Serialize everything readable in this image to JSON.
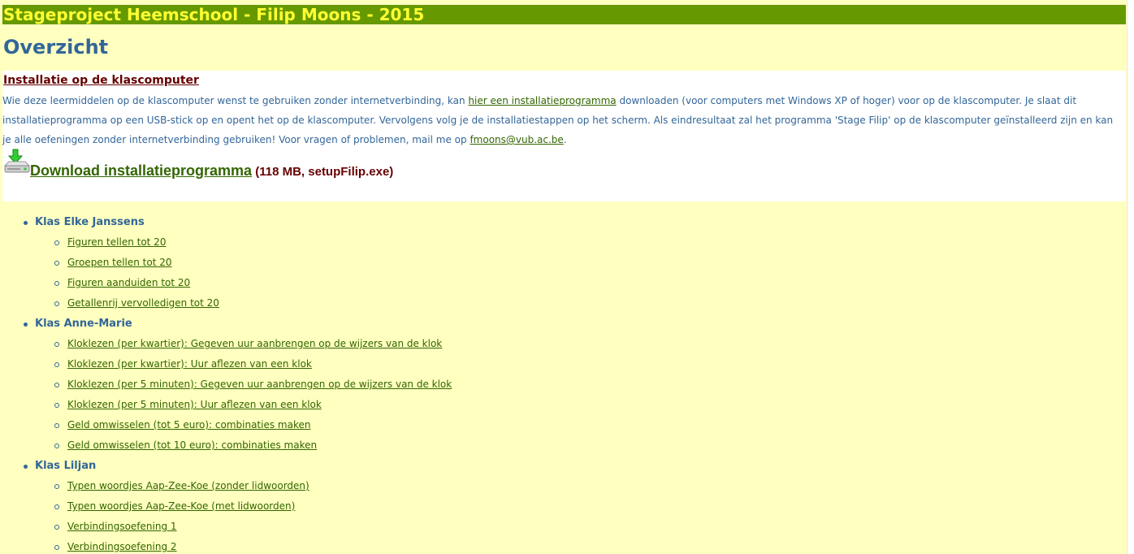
{
  "header": {
    "site_title": "Stageproject Heemschool - Filip Moons - 2015"
  },
  "main": {
    "title": "Overzicht"
  },
  "install": {
    "heading": "Installatie op de klascomputer",
    "text_1": "Wie deze leermiddelen op de klascomputer wenst te gebruiken zonder internetverbinding, kan ",
    "link_installer": "hier een installatieprogramma",
    "text_2": " downloaden (voor computers met Windows XP of hoger) voor op de klascomputer. Je slaat dit installatieprogramma op een USB-stick op en opent het op de klascomputer. Vervolgens volg je de installatiestappen op het scherm. Als eindresultaat zal het programma 'Stage Filip' op de klascomputer geïnstalleerd zijn en kan je alle oefeningen zonder internetverbinding gebruiken! Voor vragen of problemen, mail me op ",
    "email": "fmoons@vub.ac.be",
    "text_3": ".",
    "download_label": "Download installatieprogramma",
    "download_meta": " (118 MB, setupFilip.exe)",
    "download_icon": "download-drive-icon"
  },
  "klassen": [
    {
      "name": "Klas Elke Janssens",
      "items": [
        "Figuren tellen tot 20",
        "Groepen tellen tot 20",
        "Figuren aanduiden tot 20",
        "Getallenrij vervolledigen tot 20"
      ]
    },
    {
      "name": "Klas Anne-Marie",
      "items": [
        "Kloklezen (per kwartier): Gegeven uur aanbrengen op de wijzers van de klok",
        "Kloklezen (per kwartier): Uur aflezen van een klok",
        "Kloklezen (per 5 minuten): Gegeven uur aanbrengen op de wijzers van de klok",
        "Kloklezen (per 5 minuten): Uur aflezen van een klok",
        "Geld omwisselen (tot 5 euro): combinaties maken",
        "Geld omwisselen (tot 10 euro): combinaties maken"
      ]
    },
    {
      "name": "Klas Liljan",
      "items": [
        "Typen woordjes Aap-Zee-Koe (zonder lidwoorden)",
        "Typen woordjes Aap-Zee-Koe (met lidwoorden)",
        "Verbindingsoefening 1",
        "Verbindingsoefening 2"
      ]
    }
  ],
  "colors": {
    "page_bg": "#ffffc0",
    "header_bar": "#669900",
    "header_text": "#ffff33",
    "title": "#336699",
    "link": "#336600",
    "heading_dark_red": "#660000"
  }
}
